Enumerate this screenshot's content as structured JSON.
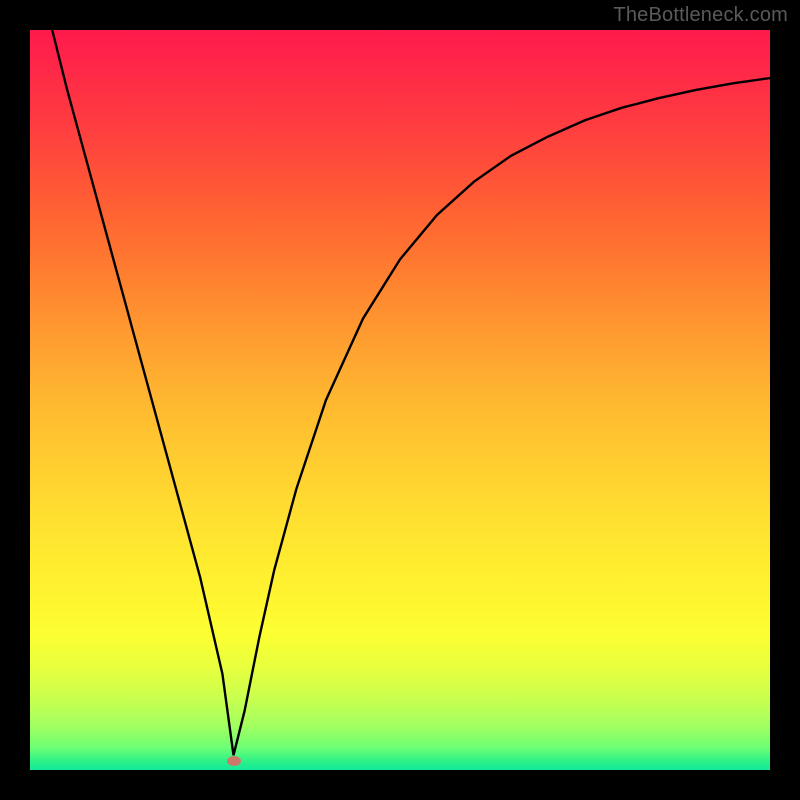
{
  "attribution": "TheBottleneck.com",
  "colors": {
    "frame": "#000000",
    "curve": "#000000",
    "marker": "#c97a6a",
    "gradient_top": "#ff1a4d",
    "gradient_bottom": "#14e89c"
  },
  "chart_data": {
    "type": "line",
    "title": "",
    "xlabel": "",
    "ylabel": "",
    "xlim": [
      0,
      100
    ],
    "ylim": [
      0,
      100
    ],
    "grid": false,
    "legend": false,
    "annotations": [
      "TheBottleneck.com"
    ],
    "series": [
      {
        "name": "bottleneck-curve",
        "x": [
          3,
          5,
          8,
          11,
          14,
          17,
          20,
          23,
          26,
          27.5,
          29,
          31,
          33,
          36,
          40,
          45,
          50,
          55,
          60,
          65,
          70,
          75,
          80,
          85,
          90,
          95,
          100
        ],
        "y": [
          100,
          92,
          81,
          70,
          59,
          48,
          37,
          26,
          13,
          2,
          8,
          18,
          27,
          38,
          50,
          61,
          69,
          75,
          79.5,
          83,
          85.6,
          87.8,
          89.5,
          90.8,
          91.9,
          92.8,
          93.5
        ]
      }
    ],
    "marker": {
      "x": 27.5,
      "y": 1.2
    }
  }
}
